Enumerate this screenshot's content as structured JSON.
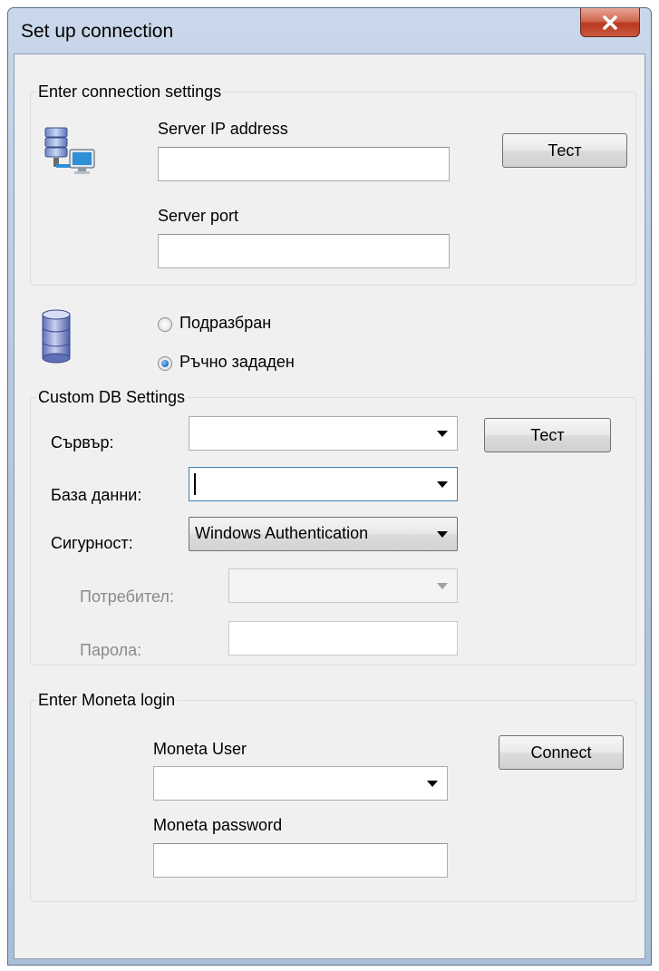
{
  "window": {
    "title": "Set up connection"
  },
  "connection": {
    "group_title": "Enter connection settings",
    "server_ip_label": "Server IP address",
    "server_ip_value": "",
    "server_port_label": "Server port",
    "server_port_value": "",
    "test_button": "Тест",
    "icon": "server-network-icon"
  },
  "db_mode": {
    "icon": "database-icon",
    "options": [
      {
        "label": "Подразбран",
        "selected": false
      },
      {
        "label": "Ръчно зададен",
        "selected": true
      }
    ]
  },
  "custom_db": {
    "group_title": "Custom DB Settings",
    "server_label": "Сървър:",
    "server_value": "",
    "database_label": "База данни:",
    "database_value": "",
    "security_label": "Сигурност:",
    "security_value": "Windows Authentication",
    "user_label": "Потребител:",
    "user_value": "",
    "password_label": "Парола:",
    "password_value": "",
    "test_button": "Тест"
  },
  "moneta_login": {
    "group_title": "Enter Moneta login",
    "user_label": "Moneta User",
    "user_value": "",
    "password_label": "Moneta password",
    "password_value": "",
    "connect_button": "Connect"
  },
  "colors": {
    "titlebar": "#b5c9e0",
    "client_bg": "#f0f0f0",
    "close_button": "#c95a3e",
    "radio_selected": "#1f6fc0"
  }
}
